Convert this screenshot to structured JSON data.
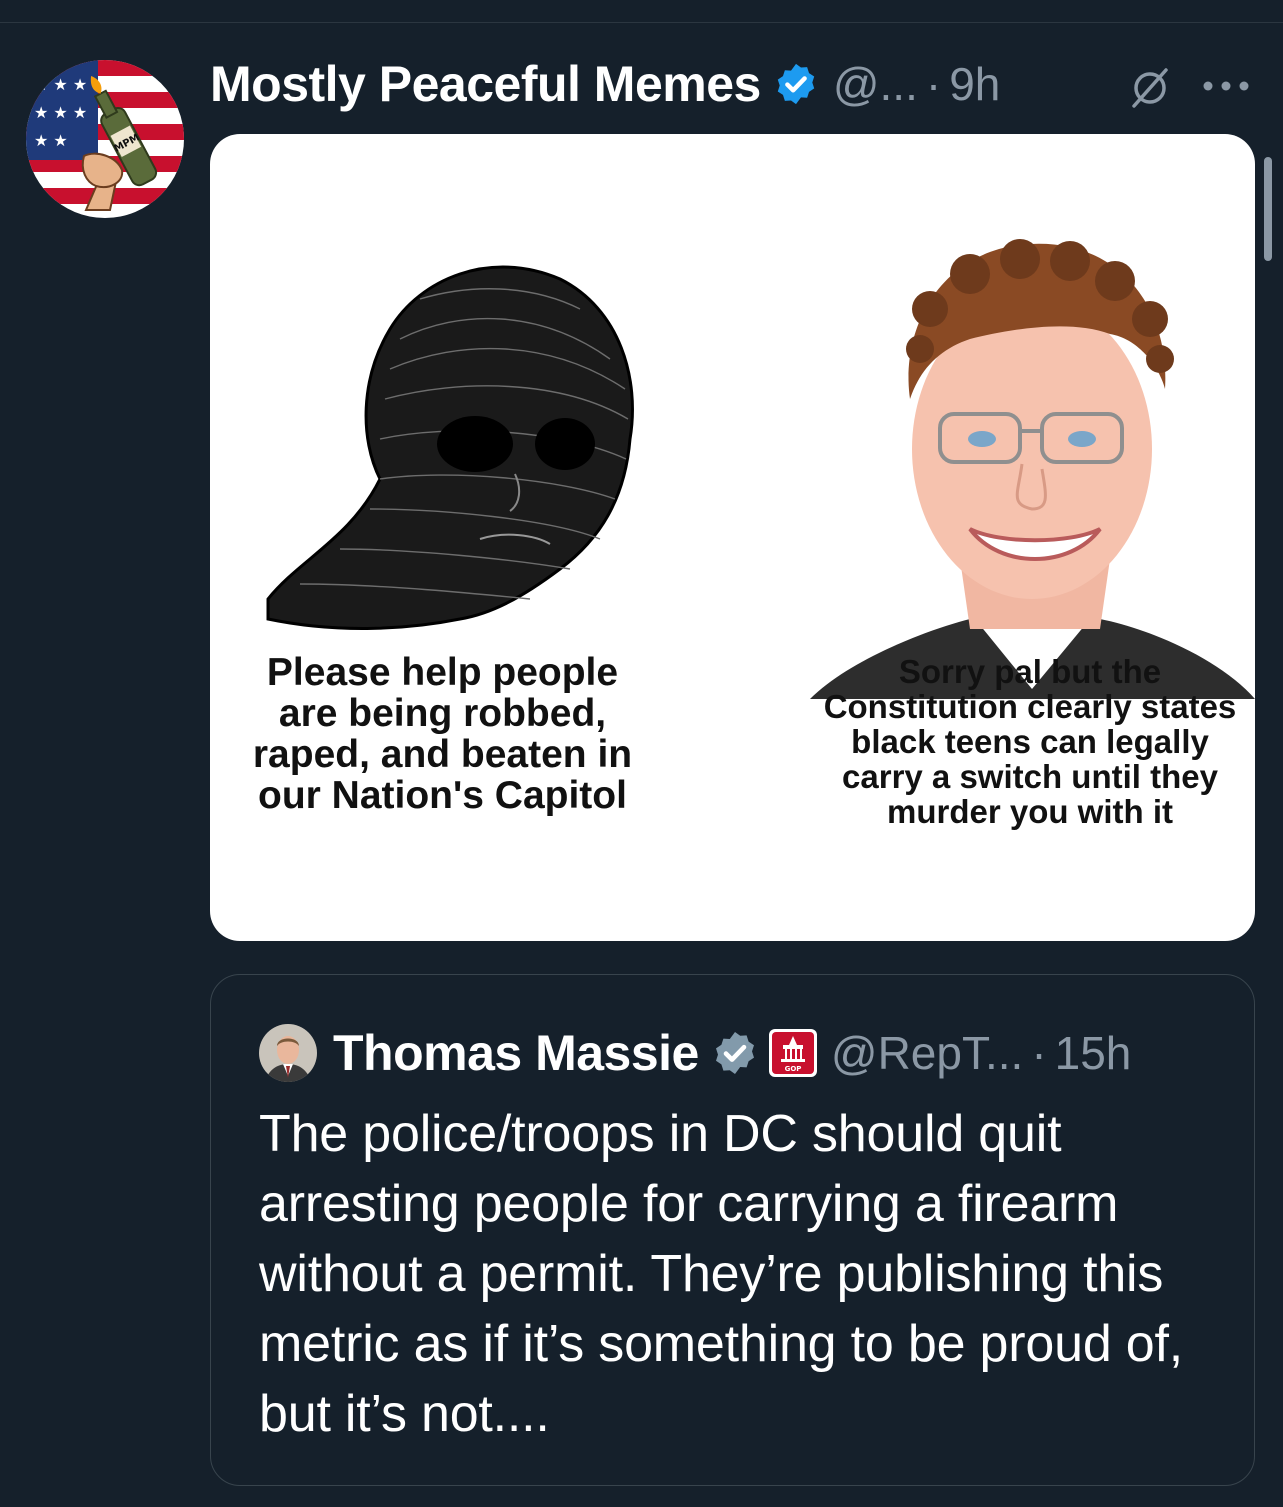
{
  "colors": {
    "background": "#15202b",
    "text_primary": "#ffffff",
    "text_secondary": "#8b98a5",
    "verified_blue": "#1d9bf0",
    "verified_gray": "#829aab",
    "gop_red": "#c8102e",
    "border": "#38444d"
  },
  "post": {
    "author_name": "Mostly Peaceful Memes",
    "handle": "@...",
    "separator": "·",
    "time": "9h",
    "avatar_icon": "flag-bottle-avatar",
    "avatar_label": "MPM",
    "media": {
      "left_caption": "Please help people\nare being robbed,\nraped, and beaten in\nour Nation's Capitol",
      "right_caption": "Sorry pal but the\nConstitution clearly states\nblack teens can legally\ncarry a switch until they\nmurder you with it"
    }
  },
  "quote": {
    "author_name": "Thomas Massie",
    "handle": "@RepT...",
    "separator": "·",
    "time": "15h",
    "badge_label": "GOP",
    "text": "The police/troops in DC should quit arresting people for carrying a firearm without a permit. They’re publishing this metric as if it’s something to be proud of, but it’s not...."
  }
}
